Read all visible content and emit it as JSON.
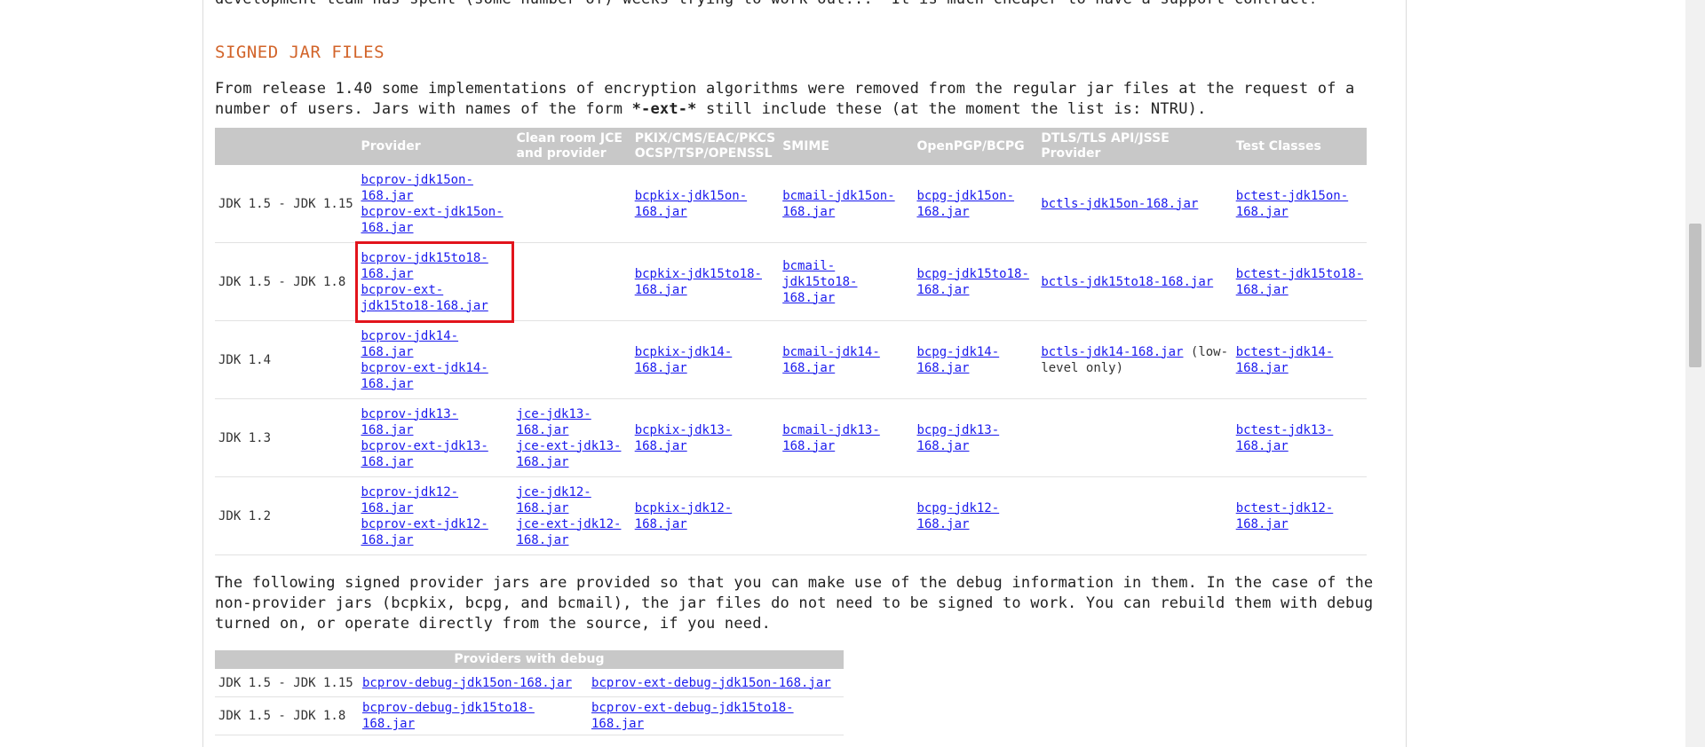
{
  "intro_text": "development team has spent (some number of) weeks trying to work out...\" It is much cheaper to have a support contract!",
  "section_title": "SIGNED JAR FILES",
  "para1_a": "From release 1.40 some implementations of encryption algorithms were removed from the regular jar files at the request of a number of users. Jars with names of the form ",
  "para1_bold": "*-ext-*",
  "para1_b": " still include these (at the moment the list is: NTRU).",
  "jar_table": {
    "headers": [
      "",
      "Provider",
      "Clean room JCE and provider",
      "PKIX/CMS/EAC/PKCS OCSP/TSP/OPENSSL",
      "SMIME",
      "OpenPGP/BCPG",
      "DTLS/TLS API/JSSE Provider",
      "Test Classes"
    ],
    "rows": [
      {
        "jdk": "JDK 1.5 - JDK 1.15",
        "provider": [
          "bcprov-jdk15on-168.jar",
          "bcprov-ext-jdk15on-168.jar"
        ],
        "cleanroom": [],
        "pkix": "bcpkix-jdk15on-168.jar",
        "smime": "bcmail-jdk15on-168.jar",
        "pgp": "bcpg-jdk15on-168.jar",
        "tls": "bctls-jdk15on-168.jar",
        "tls_note": "",
        "test": "bctest-jdk15on-168.jar"
      },
      {
        "jdk": "JDK 1.5 - JDK 1.8",
        "provider": [
          "bcprov-jdk15to18-168.jar",
          "bcprov-ext-jdk15to18-168.jar"
        ],
        "cleanroom": [],
        "pkix": "bcpkix-jdk15to18-168.jar",
        "smime": "bcmail-jdk15to18-168.jar",
        "pgp": "bcpg-jdk15to18-168.jar",
        "tls": "bctls-jdk15to18-168.jar",
        "tls_note": "",
        "test": "bctest-jdk15to18-168.jar"
      },
      {
        "jdk": "JDK 1.4",
        "provider": [
          "bcprov-jdk14-168.jar",
          "bcprov-ext-jdk14-168.jar"
        ],
        "cleanroom": [],
        "pkix": "bcpkix-jdk14-168.jar",
        "smime": "bcmail-jdk14-168.jar",
        "pgp": "bcpg-jdk14-168.jar",
        "tls": "bctls-jdk14-168.jar",
        "tls_note": " (low-level only)",
        "test": "bctest-jdk14-168.jar"
      },
      {
        "jdk": "JDK 1.3",
        "provider": [
          "bcprov-jdk13-168.jar",
          "bcprov-ext-jdk13-168.jar"
        ],
        "cleanroom": [
          "jce-jdk13-168.jar",
          "jce-ext-jdk13-168.jar"
        ],
        "pkix": "bcpkix-jdk13-168.jar",
        "smime": "bcmail-jdk13-168.jar",
        "pgp": "bcpg-jdk13-168.jar",
        "tls": "",
        "tls_note": "",
        "test": "bctest-jdk13-168.jar"
      },
      {
        "jdk": "JDK 1.2",
        "provider": [
          "bcprov-jdk12-168.jar",
          "bcprov-ext-jdk12-168.jar"
        ],
        "cleanroom": [
          "jce-jdk12-168.jar",
          "jce-ext-jdk12-168.jar"
        ],
        "pkix": "bcpkix-jdk12-168.jar",
        "smime": "",
        "pgp": "bcpg-jdk12-168.jar",
        "tls": "",
        "tls_note": "",
        "test": "bctest-jdk12-168.jar"
      }
    ]
  },
  "para2": "The following signed provider jars are provided so that you can make use of the debug information in them. In the case of the non-provider jars (bcpkix, bcpg, and bcmail), the jar files do not need to be signed to work. You can rebuild them with debug turned on, or operate directly from the source, if you need.",
  "debug_table": {
    "header": "Providers with debug",
    "rows": [
      {
        "jdk": "JDK 1.5 - JDK 1.15",
        "debug": "bcprov-debug-jdk15on-168.jar",
        "ext_debug": "bcprov-ext-debug-jdk15on-168.jar"
      },
      {
        "jdk": "JDK 1.5 - JDK 1.8",
        "debug": "bcprov-debug-jdk15to18-168.jar",
        "ext_debug": "bcprov-ext-debug-jdk15to18-168.jar"
      }
    ]
  },
  "colors": {
    "heading": "#d2642a",
    "link": "#1a1aee",
    "table_header_bg": "#c8c8c8",
    "highlight_box": "#e2141c"
  }
}
